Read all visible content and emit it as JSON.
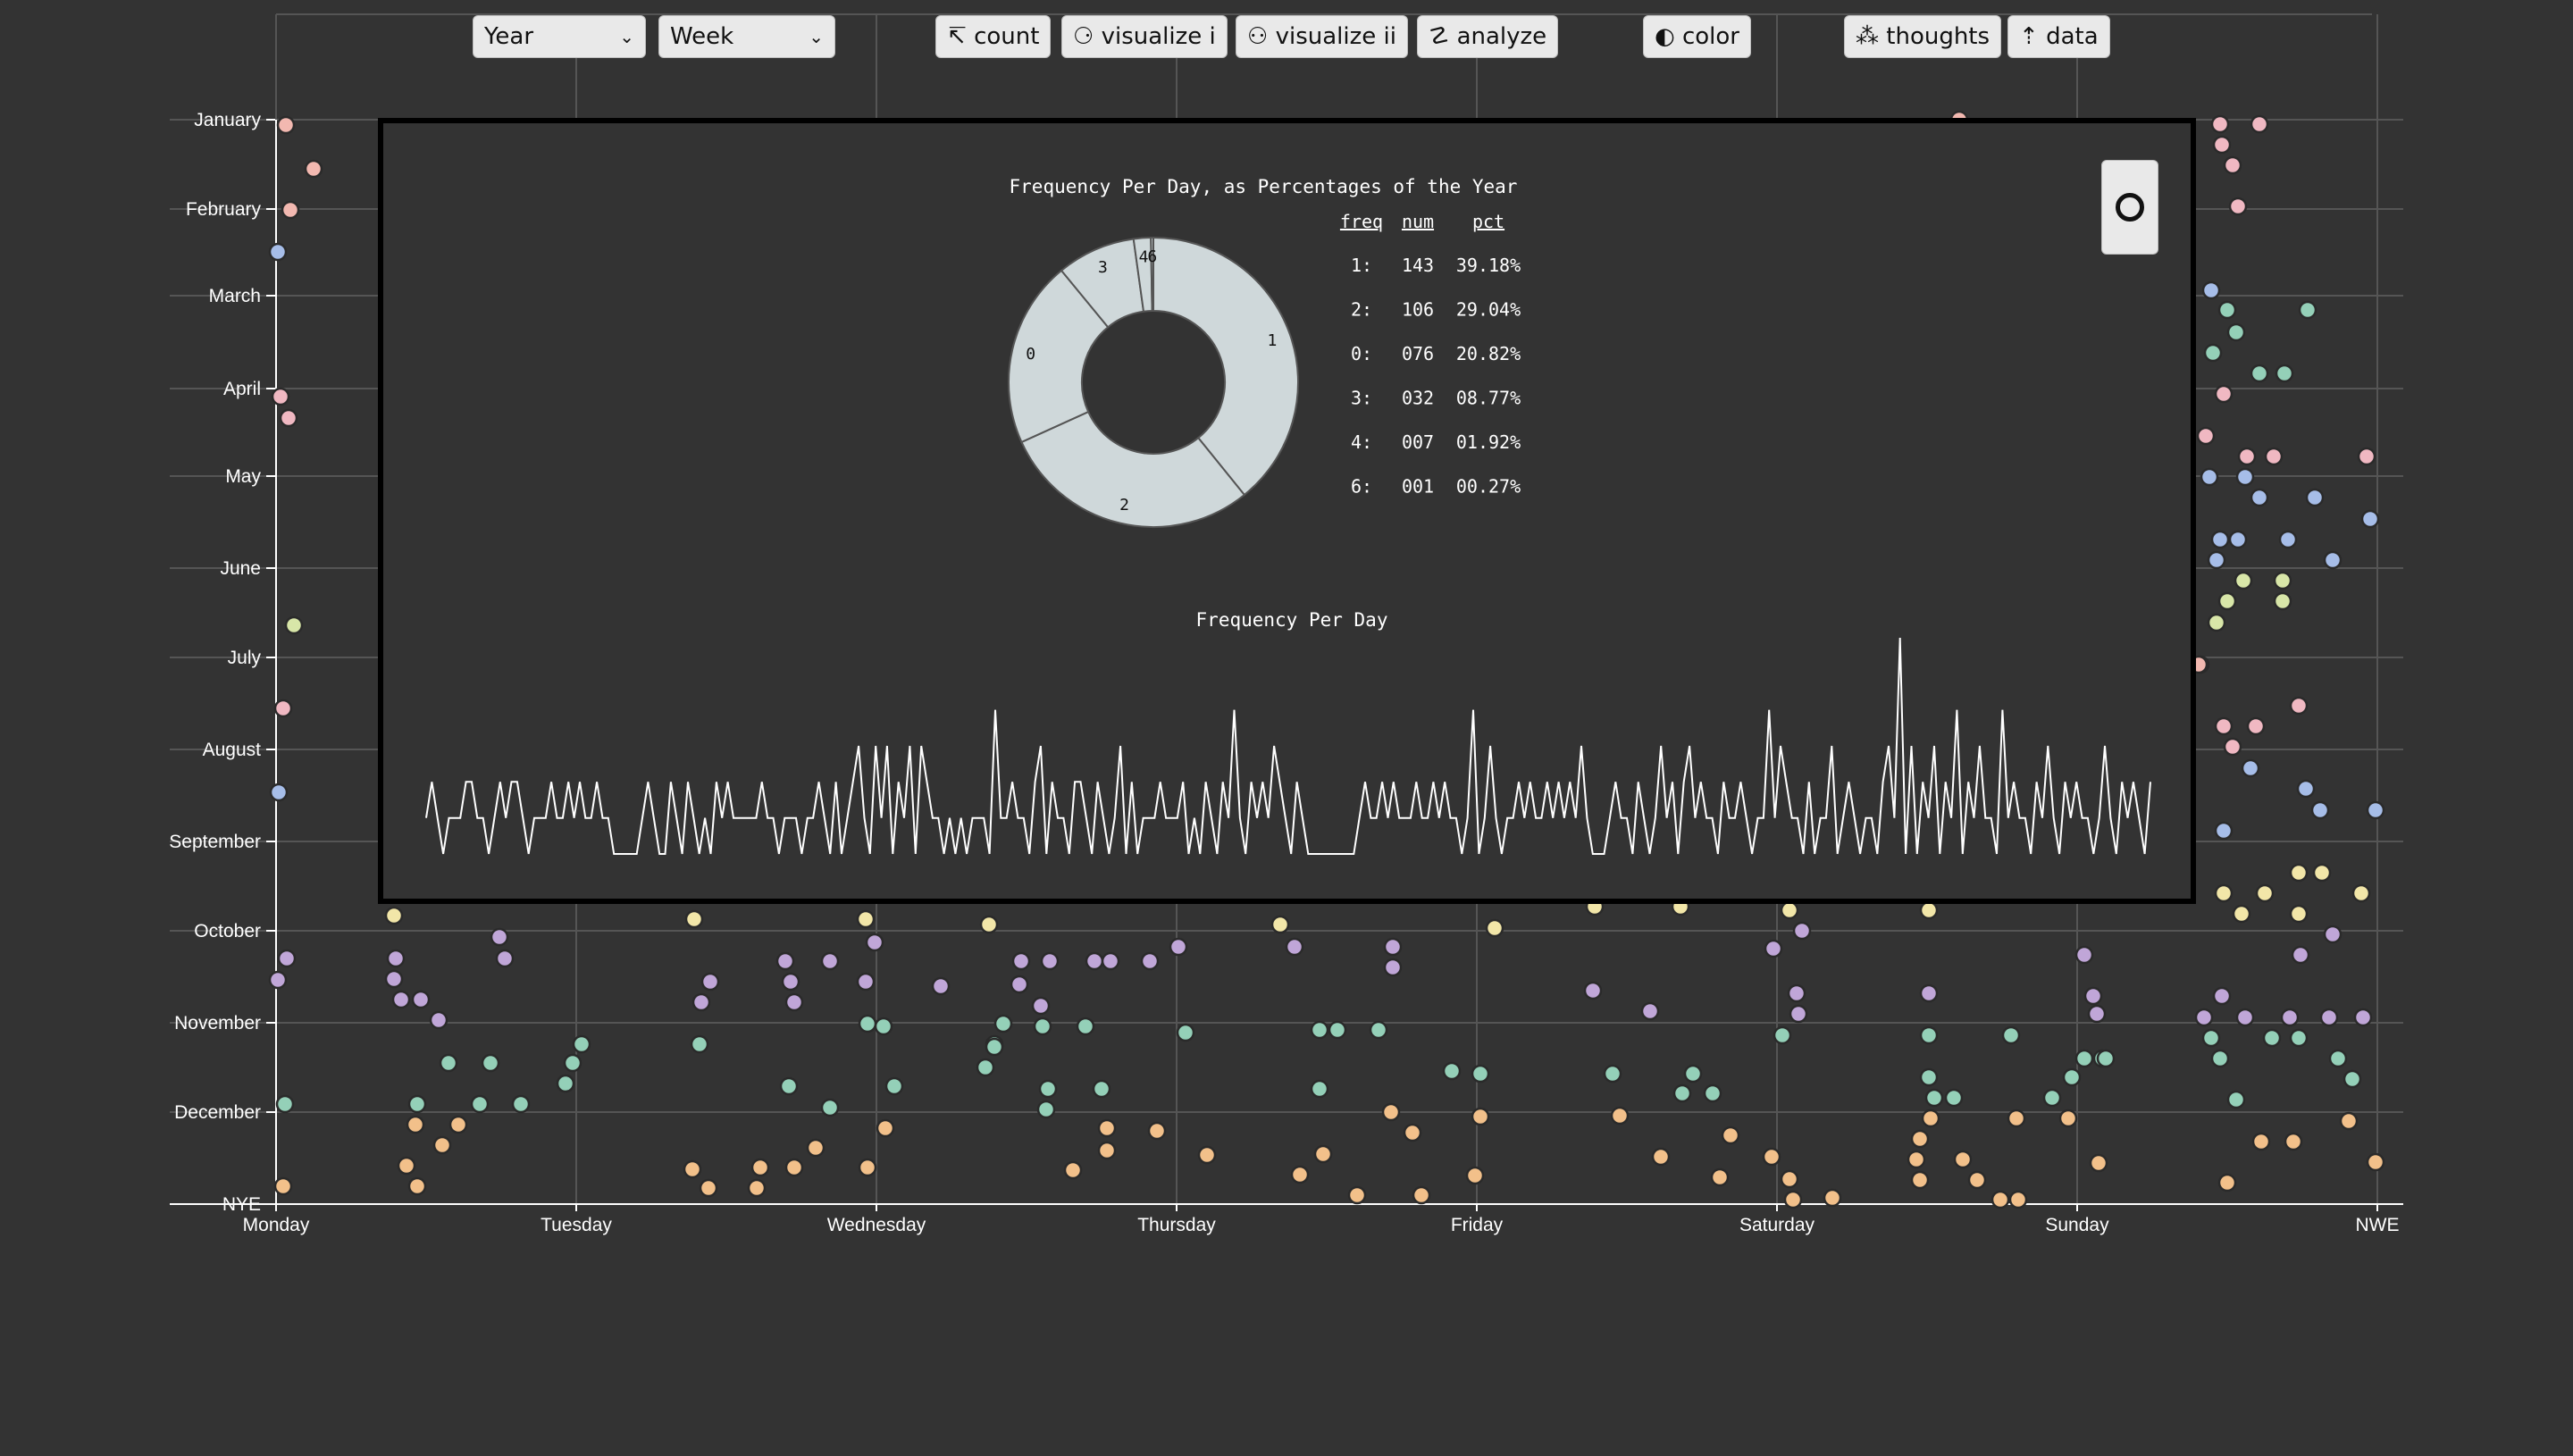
{
  "toolbar": {
    "selects": [
      {
        "value": "Year"
      },
      {
        "value": "Week"
      }
    ],
    "buttons": [
      {
        "icon": "↸",
        "label": "count"
      },
      {
        "icon": "⚆",
        "label": "visualize i"
      },
      {
        "icon": "⚇",
        "label": "visualize ii"
      },
      {
        "icon": "☡",
        "label": "analyze"
      },
      {
        "icon": "◐",
        "label": "color"
      },
      {
        "icon": "⁂",
        "label": "thoughts"
      },
      {
        "icon": "⇡",
        "label": "data"
      }
    ]
  },
  "colors": {
    "background": "#333333",
    "grid": "#555555",
    "jan_feb": "#f2b8b0",
    "mar_apr": "#f0b8c2",
    "may_jun": "#a6bde8",
    "jul_aug": "#d8e6a8",
    "sep_oct": "#f2e6a8",
    "oct_nov": "#c0a6d8",
    "nov_dec": "#94d0b8",
    "dec": "#f2c08a",
    "donut": "#cfd8da",
    "line": "#ffffff"
  },
  "chart_data": [
    {
      "type": "scatter",
      "x_axis": {
        "ticks": [
          "Monday",
          "Tuesday",
          "Wednesday",
          "Thursday",
          "Friday",
          "Saturday",
          "Sunday",
          "NWE"
        ]
      },
      "y_axis": {
        "ticks": [
          "January",
          "February",
          "March",
          "April",
          "May",
          "June",
          "July",
          "August",
          "September",
          "October",
          "November",
          "December",
          "NYE"
        ]
      },
      "grid": true
    },
    {
      "type": "pie",
      "title": "Frequency Per Day, as Percentages of the Year",
      "donut": true,
      "slices": [
        {
          "label": "1",
          "value": 143
        },
        {
          "label": "2",
          "value": 106
        },
        {
          "label": "0",
          "value": 76
        },
        {
          "label": "3",
          "value": 32
        },
        {
          "label": "4",
          "value": 7
        },
        {
          "label": "6",
          "value": 1
        }
      ],
      "table": {
        "headers": [
          "freq",
          "num",
          "pct"
        ],
        "rows": [
          [
            "1:",
            "143",
            "39.18%"
          ],
          [
            "2:",
            "106",
            "29.04%"
          ],
          [
            "0:",
            "076",
            "20.82%"
          ],
          [
            "3:",
            "032",
            "08.77%"
          ],
          [
            "4:",
            "007",
            "01.92%"
          ],
          [
            "6:",
            "001",
            "00.27%"
          ]
        ]
      }
    },
    {
      "type": "line",
      "title": "Frequency Per Day",
      "ylim": [
        0,
        6
      ],
      "values": [
        1,
        2,
        1,
        0,
        1,
        1,
        1,
        2,
        2,
        1,
        1,
        0,
        1,
        2,
        1,
        2,
        2,
        1,
        0,
        1,
        1,
        1,
        2,
        1,
        1,
        2,
        1,
        2,
        1,
        1,
        2,
        1,
        1,
        0,
        0,
        0,
        0,
        0,
        1,
        2,
        1,
        0,
        0,
        2,
        1,
        0,
        2,
        1,
        0,
        1,
        0,
        2,
        1,
        2,
        1,
        1,
        1,
        1,
        1,
        2,
        1,
        1,
        0,
        1,
        1,
        1,
        0,
        1,
        1,
        2,
        1,
        0,
        2,
        0,
        1,
        2,
        3,
        1,
        0,
        3,
        1,
        3,
        0,
        2,
        1,
        3,
        0,
        3,
        2,
        1,
        1,
        0,
        1,
        0,
        1,
        0,
        1,
        1,
        1,
        0,
        4,
        1,
        1,
        2,
        1,
        1,
        0,
        2,
        3,
        0,
        2,
        1,
        1,
        0,
        2,
        2,
        1,
        0,
        2,
        1,
        0,
        1,
        3,
        0,
        2,
        0,
        1,
        1,
        1,
        2,
        1,
        1,
        1,
        2,
        0,
        1,
        0,
        2,
        1,
        0,
        2,
        1,
        4,
        1,
        0,
        2,
        1,
        2,
        1,
        3,
        2,
        1,
        0,
        2,
        1,
        0,
        0,
        0,
        0,
        0,
        0,
        0,
        0,
        0,
        1,
        2,
        1,
        1,
        2,
        1,
        2,
        1,
        1,
        1,
        2,
        1,
        1,
        2,
        1,
        2,
        1,
        1,
        0,
        1,
        4,
        0,
        1,
        3,
        1,
        0,
        1,
        1,
        2,
        1,
        2,
        1,
        1,
        2,
        1,
        2,
        1,
        2,
        1,
        3,
        1,
        0,
        0,
        0,
        1,
        2,
        1,
        1,
        0,
        2,
        1,
        0,
        1,
        3,
        1,
        2,
        0,
        2,
        3,
        1,
        2,
        1,
        1,
        0,
        2,
        1,
        1,
        2,
        1,
        0,
        1,
        1,
        4,
        1,
        3,
        2,
        1,
        1,
        0,
        2,
        0,
        1,
        1,
        3,
        0,
        1,
        2,
        1,
        0,
        1,
        1,
        0,
        2,
        3,
        1,
        6,
        0,
        3,
        0,
        2,
        1,
        3,
        0,
        2,
        1,
        4,
        0,
        2,
        1,
        3,
        1,
        1,
        0,
        4,
        1,
        2,
        1,
        1,
        0,
        2,
        1,
        3,
        1,
        0,
        2,
        1,
        2,
        1,
        1,
        0,
        1,
        3,
        1,
        0,
        2,
        1,
        2,
        1,
        0,
        2
      ]
    }
  ],
  "modal": {
    "pie_title": "Frequency Per Day, as Percentages of the Year",
    "line_title": "Frequency Per Day"
  }
}
